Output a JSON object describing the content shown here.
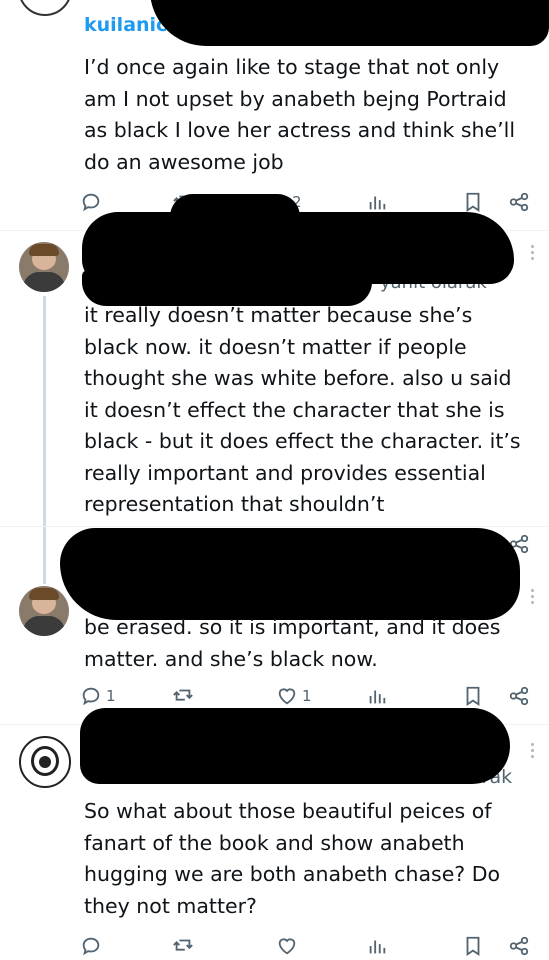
{
  "tweets": [
    {
      "handle_fragment": "kuilanic",
      "text": "I’d once again like to stage that not only am I not upset by anabeth bejng Portraid as black I love her actress and think she’ll do an awesome job",
      "actions": {
        "reply": "",
        "retweet": "",
        "like": "2",
        "views": ""
      }
    },
    {
      "handle_fragment": "yanıt olarak",
      "text": "it really doesn’t matter because she’s black now. it doesn’t matter if people thought she was white before. also u said it doesn’t effect the character that she is black - but it does effect the character. it’s really important and provides essential representation that shouldn’t"
    },
    {
      "text": "be erased. so it is important, and it does matter. and she’s black now.",
      "actions": {
        "reply": "1",
        "retweet": "",
        "like": "1",
        "views": ""
      }
    },
    {
      "handle_fragment": "arak",
      "text": "So what about those beautiful peices of fanart of the book and show anabeth hugging we are both anabeth chase? Do they not matter?",
      "actions": {
        "reply": "",
        "retweet": "",
        "like": "",
        "views": ""
      }
    }
  ],
  "icons": {
    "reply": "reply-icon",
    "retweet": "retweet-icon",
    "like": "like-icon",
    "views": "views-icon",
    "bookmark": "bookmark-icon",
    "share": "share-icon",
    "more": "more-options-icon"
  },
  "colors": {
    "text": "#0f1419",
    "muted": "#536471",
    "thread": "#cfd9de",
    "link": "#1d9bf0"
  }
}
